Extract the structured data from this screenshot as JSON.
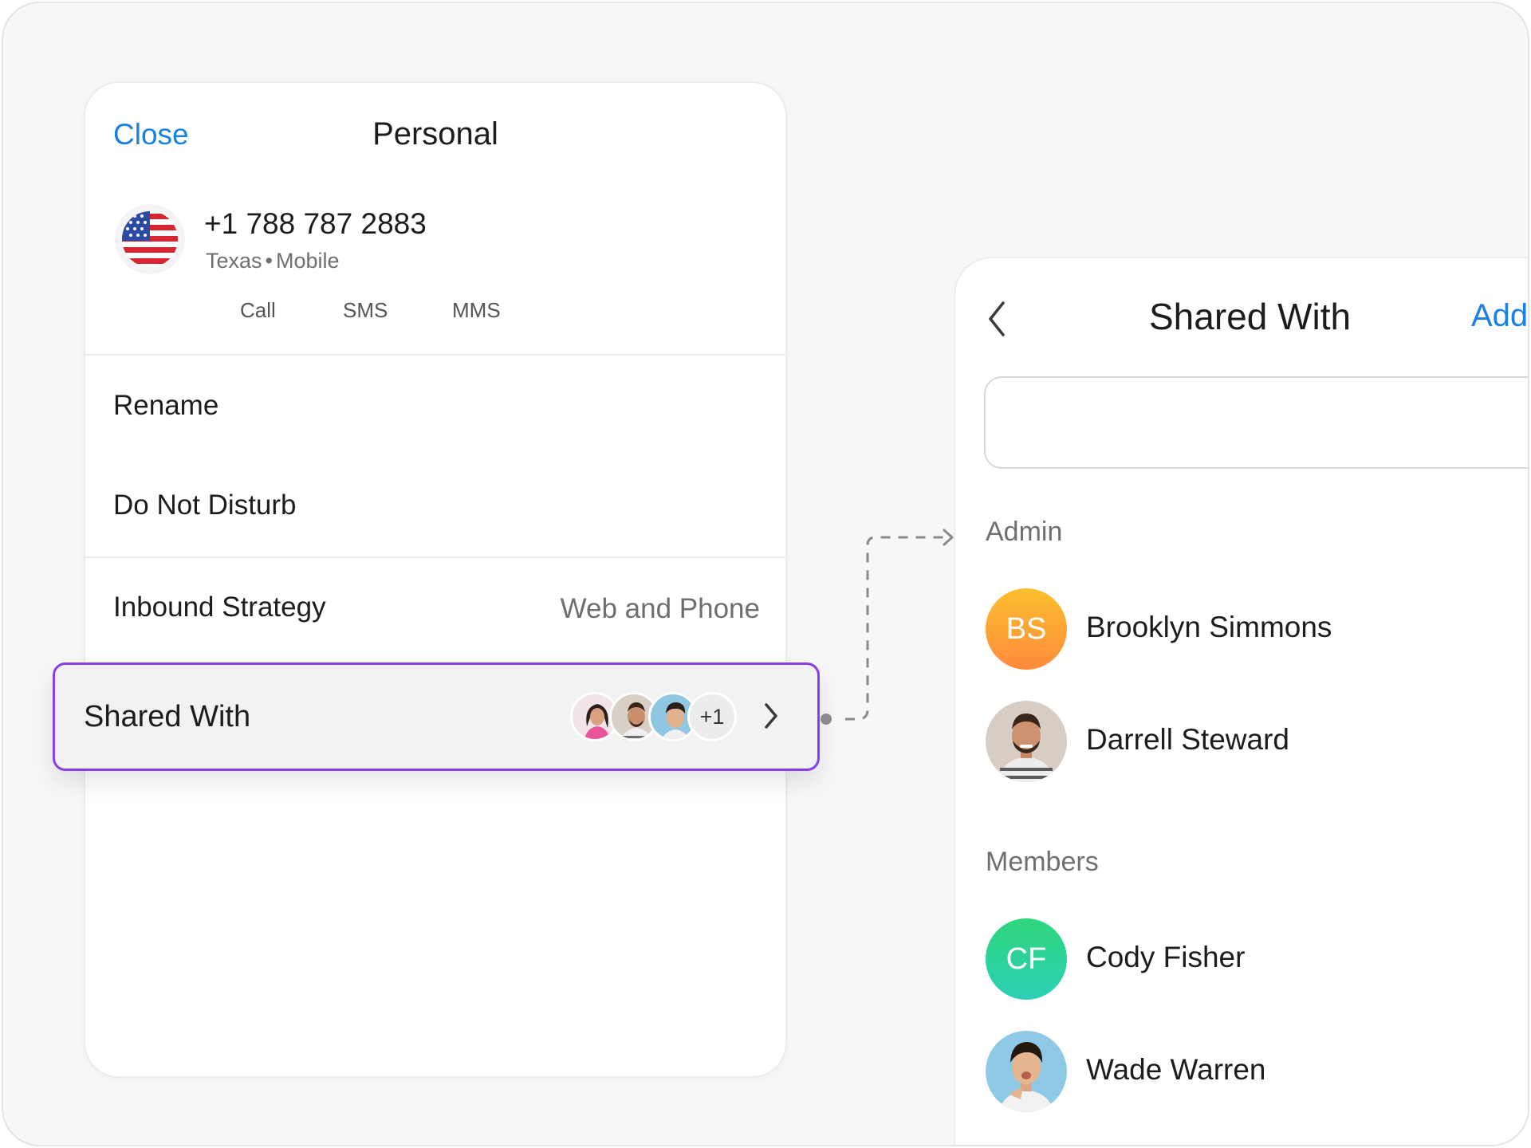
{
  "left_card": {
    "close_label": "Close",
    "title": "Personal",
    "phone": {
      "number": "+1 788 787 2883",
      "region": "Texas",
      "type": "Mobile",
      "flag_icon": "us-flag-icon"
    },
    "actions": [
      "Call",
      "SMS",
      "MMS"
    ],
    "rows": {
      "rename": "Rename",
      "do_not_disturb": "Do Not Disturb",
      "inbound_label": "Inbound Strategy",
      "inbound_value": "Web and Phone",
      "shared_label": "Shared With",
      "shared_more": "+1"
    },
    "highlight_color": "#8a3ee6"
  },
  "right_panel": {
    "title": "Shared With",
    "add_label": "Add",
    "search_value": "",
    "sections": {
      "admin": "Admin",
      "members": "Members"
    },
    "admins": [
      {
        "name": "Brooklyn Simmons",
        "initials": "BS",
        "avatar": "initials-orange"
      },
      {
        "name": "Darrell Steward",
        "initials": "",
        "avatar": "photo"
      }
    ],
    "members": [
      {
        "name": "Cody Fisher",
        "initials": "CF",
        "avatar": "initials-green"
      },
      {
        "name": "Wade Warren",
        "initials": "",
        "avatar": "photo"
      }
    ]
  },
  "colors": {
    "accent_blue": "#1a80e5",
    "highlight_purple": "#8a3ee6"
  }
}
